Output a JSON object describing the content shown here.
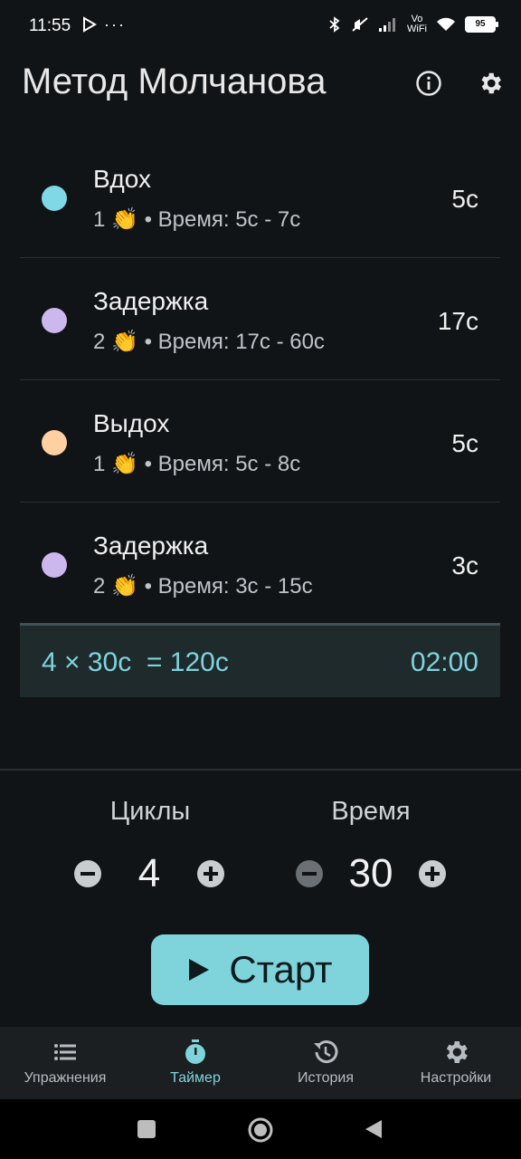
{
  "status_bar": {
    "time": "11:55",
    "battery": "95"
  },
  "header": {
    "title": "Метод Молчанова"
  },
  "phases": [
    {
      "name": "Вдох",
      "count": "1",
      "time_range": "• Время: 5с - 7с",
      "value": "5с",
      "color": "#7fd8e6"
    },
    {
      "name": "Задержка",
      "count": "2",
      "time_range": "• Время: 17с - 60с",
      "value": "17с",
      "color": "#cdb8ee"
    },
    {
      "name": "Выдох",
      "count": "1",
      "time_range": "• Время: 5с - 8с",
      "value": "5с",
      "color": "#ffd1a0"
    },
    {
      "name": "Задержка",
      "count": "2",
      "time_range": "• Время: 3с - 15с",
      "value": "3с",
      "color": "#cdb8ee"
    }
  ],
  "summary": {
    "formula": "4 × 30с  = 120с",
    "total": "02:00"
  },
  "controls": {
    "cycles": {
      "label": "Циклы",
      "value": "4"
    },
    "time": {
      "label": "Время",
      "value": "30"
    }
  },
  "start": {
    "label": "Старт"
  },
  "bottom_nav": [
    {
      "label": "Упражнения",
      "icon": "list-icon",
      "active": false
    },
    {
      "label": "Таймер",
      "icon": "timer-icon",
      "active": true
    },
    {
      "label": "История",
      "icon": "history-icon",
      "active": false
    },
    {
      "label": "Настройки",
      "icon": "settings-icon",
      "active": false
    }
  ],
  "colors": {
    "accent": "#7fd4dc",
    "background": "#111417"
  }
}
